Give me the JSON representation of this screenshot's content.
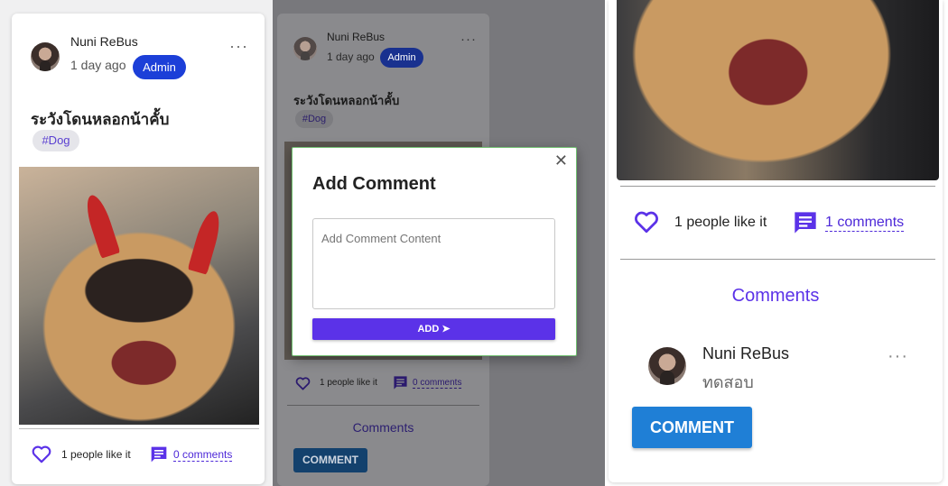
{
  "post": {
    "author": "Nuni ReBus",
    "time": "1 day ago",
    "role_badge": "Admin",
    "title": "ระวังโดนหลอกน้าคั้บ",
    "tag": "#Dog",
    "more_menu": "···"
  },
  "panel1": {
    "like_text": "1 people like it",
    "comments_link": "0 comments"
  },
  "panel2": {
    "like_text": "1 people like it",
    "comments_link": "0 comments",
    "comments_heading": "Comments",
    "comment_button": "COMMENT"
  },
  "dialog": {
    "title": "Add Comment",
    "textarea_placeholder": "Add Comment Content",
    "add_button": "ADD ➤",
    "close": "✕"
  },
  "panel3": {
    "like_text": "1 people like it",
    "comments_link": "1 comments",
    "comments_heading": "Comments",
    "comment_author": "Nuni ReBus",
    "comment_text": "ทดสอบ",
    "more_menu": "···",
    "comment_button": "COMMENT"
  },
  "colors": {
    "accent": "#5b32e8",
    "admin_badge": "#1c3fd8",
    "comment_button": "#1f7fd6",
    "link": "#4d28d8"
  },
  "icons": [
    "avatar",
    "more-icon",
    "heart-icon",
    "comment-icon",
    "close-icon",
    "send-icon"
  ]
}
